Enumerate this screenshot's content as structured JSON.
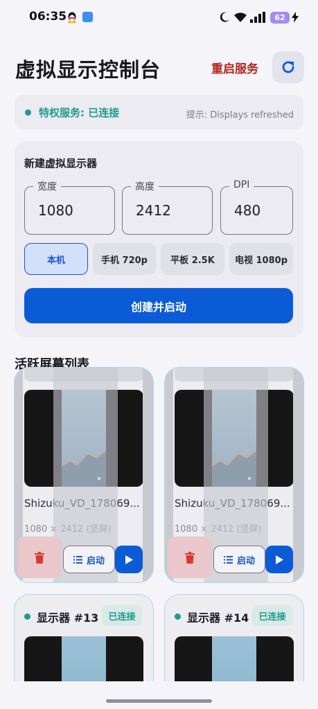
{
  "status_bar": {
    "time": "06:35",
    "battery": "62",
    "icons": [
      "qq-icon",
      "app-icon",
      "moon-icon",
      "wifi-icon",
      "signal-icon",
      "battery-icon",
      "bolt-icon"
    ]
  },
  "header": {
    "title": "虚拟显示控制台",
    "restart_label": "重启服务",
    "refresh_icon": "refresh-icon"
  },
  "service_status": {
    "label": "特权服务: 已连接",
    "hint": "提示: Displays refreshed"
  },
  "create_panel": {
    "title": "新建虚拟显示器",
    "fields": [
      {
        "label": "宽度",
        "value": "1080"
      },
      {
        "label": "高度",
        "value": "2412"
      },
      {
        "label": "DPI",
        "value": "480"
      }
    ],
    "presets": [
      {
        "label": "本机",
        "active": true
      },
      {
        "label": "手机 720p",
        "active": false
      },
      {
        "label": "平板 2.5K",
        "active": false
      },
      {
        "label": "电视 1080p",
        "active": false
      }
    ],
    "create_label": "创建并启动"
  },
  "display_list": {
    "title": "活跃屏幕列表",
    "cards": [
      {
        "name": "Shizuku_VD_178069...",
        "resolution": "1080 × 2412 (竖屏)",
        "launch_label": "启动"
      },
      {
        "name": "Shizuku_VD_178069...",
        "resolution": "1080 × 2412 (竖屏)",
        "launch_label": "启动"
      },
      {
        "name": "显示器 #13",
        "badge": "已连接"
      },
      {
        "name": "显示器 #14",
        "badge": "已连接"
      }
    ]
  },
  "colors": {
    "accent": "#0b5bd7",
    "danger": "#b3261e",
    "success": "#1e9c8c",
    "background": "#f4f4f9"
  }
}
